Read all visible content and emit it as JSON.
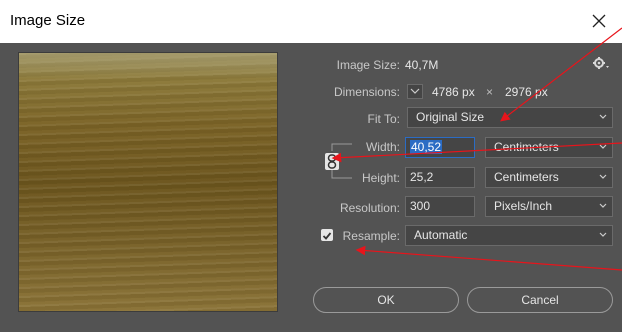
{
  "window": {
    "title": "Image Size"
  },
  "info": {
    "image_size_label": "Image Size:",
    "image_size_value": "40,7M",
    "dimensions_label": "Dimensions:",
    "dimensions_width": "4786 px",
    "dimensions_sep": "×",
    "dimensions_height": "2976 px"
  },
  "fit_to": {
    "label": "Fit To:",
    "value": "Original Size"
  },
  "width": {
    "label": "Width:",
    "value": "40,52",
    "unit": "Centimeters"
  },
  "height": {
    "label": "Height:",
    "value": "25,2",
    "unit": "Centimeters"
  },
  "resolution": {
    "label": "Resolution:",
    "value": "300",
    "unit": "Pixels/Inch"
  },
  "resample": {
    "label": "Resample:",
    "value": "Automatic",
    "checked": true
  },
  "buttons": {
    "ok": "OK",
    "cancel": "Cancel"
  },
  "colors": {
    "annotation_arrow": "#e8141b",
    "selection": "#2b6cc4",
    "panel": "#535353"
  }
}
